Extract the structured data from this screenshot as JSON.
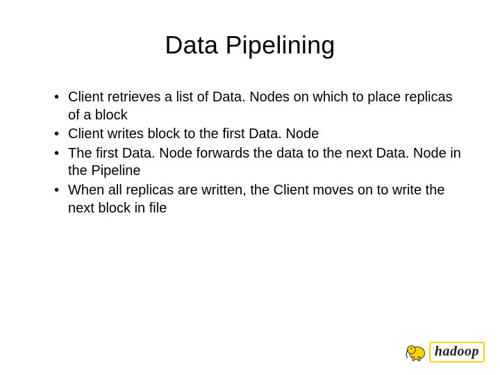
{
  "title": "Data Pipelining",
  "bullets": [
    "Client retrieves a list of Data. Nodes on which to place replicas of a block",
    "Client writes block to the first Data. Node",
    "The first Data. Node forwards the data to the next Data. Node in the Pipeline",
    "When all replicas are written, the Client moves on to write the next block in file"
  ],
  "logo": {
    "text": "hadoop",
    "icon_name": "elephant-icon"
  }
}
